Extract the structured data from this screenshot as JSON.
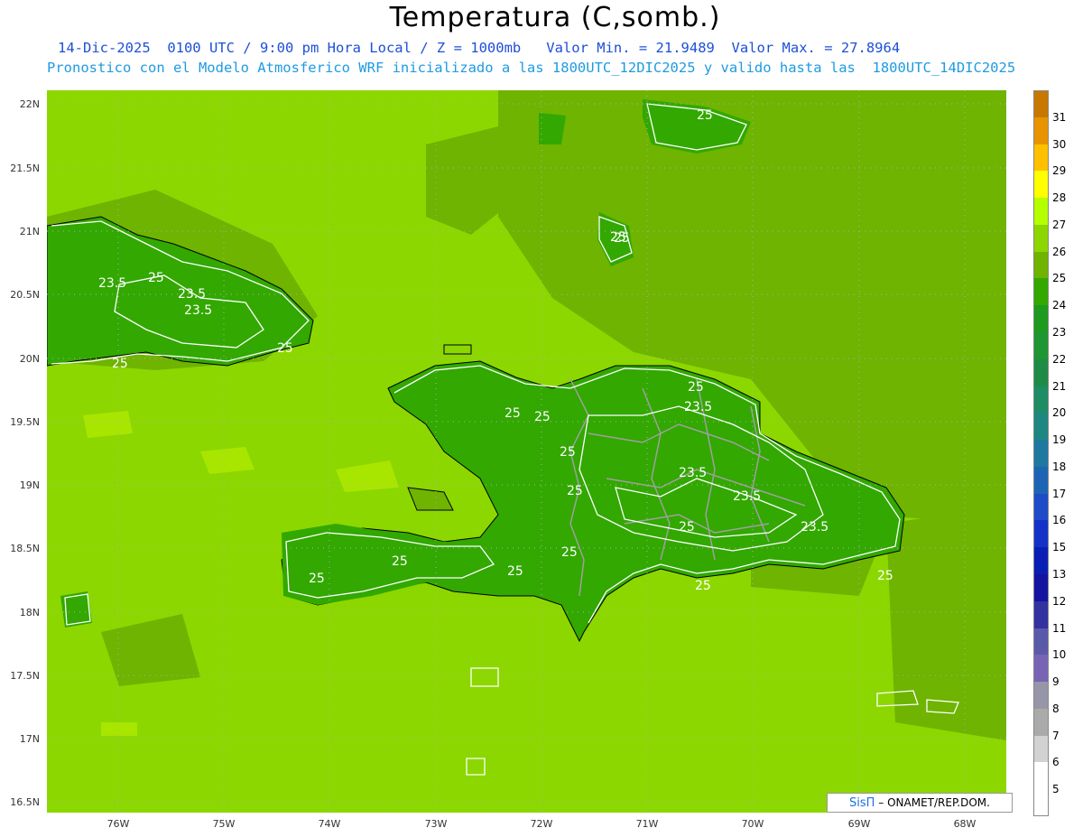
{
  "title": "Temperatura (C,somb.)",
  "subtitle_line1": "14-Dic-2025  0100 UTC / 9:00 pm Hora Local / Z = 1000mb   Valor Min. = 21.9489  Valor Max. = 27.8964",
  "subtitle_line2": "Pronostico con el Modelo Atmosferico WRF inicializado a las 1800UTC_12DIC2025 y valido hasta las  1800UTC_14DIC2025",
  "latitude_ticks": [
    "22N",
    "21.5N",
    "21N",
    "20.5N",
    "20N",
    "19.5N",
    "19N",
    "18.5N",
    "18N",
    "17.5N",
    "17N",
    "16.5N"
  ],
  "longitude_ticks": [
    "76W",
    "75W",
    "74W",
    "73W",
    "72W",
    "71W",
    "70W",
    "69W",
    "68W"
  ],
  "colorbar": {
    "labels": [
      "31",
      "30",
      "29",
      "28",
      "27",
      "26",
      "25",
      "24",
      "23",
      "22",
      "21",
      "20",
      "19",
      "18",
      "17",
      "16",
      "15",
      "13",
      "12",
      "11",
      "10",
      "9",
      "8",
      "7",
      "6",
      "5"
    ],
    "colors": [
      "#c87800",
      "#e89400",
      "#ffc000",
      "#ffff00",
      "#b4ff00",
      "#8cd700",
      "#6eb400",
      "#32a800",
      "#1e9a1e",
      "#1e9632",
      "#1e8c46",
      "#1e8c64",
      "#1e8782",
      "#1e78a0",
      "#1e64b4",
      "#1e4bc8",
      "#1432c8",
      "#0a1eb4",
      "#1414a0",
      "#3232a0",
      "#5a5aaa",
      "#7864b4",
      "#9696a8",
      "#aaaaaa",
      "#d2d2d2",
      "#ffffff"
    ]
  },
  "contour_labels": [
    "25",
    "23.5",
    "23.5",
    "25",
    "23.5",
    "25",
    "25",
    "25",
    "25",
    "25",
    "25",
    "25",
    "25",
    "23.5",
    "23.5",
    "23.5",
    "23.5",
    "25",
    "25",
    "25",
    "25",
    "25",
    "25",
    "25",
    "25"
  ],
  "credit": {
    "brand": "SisΠ",
    "text": "– ONAMET/REP.DOM."
  },
  "colors": {
    "sea": "#8cd700",
    "land_warm": "#6eb400",
    "land_cool": "#32a800",
    "highlight": "#a8e600",
    "title_blue": "#1e4fd8",
    "title_cyan": "#1e9be0"
  }
}
